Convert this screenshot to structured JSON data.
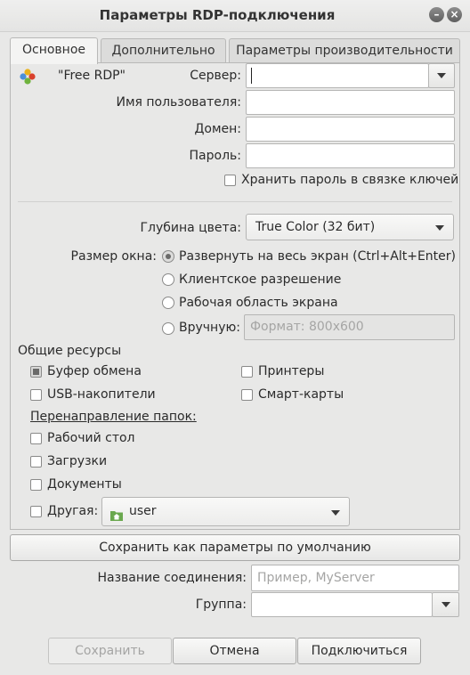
{
  "window": {
    "title": "Параметры RDP-подключения",
    "minimize_glyph": "–",
    "close_glyph": "×"
  },
  "tabs": [
    {
      "label": "Основное",
      "active": true
    },
    {
      "label": "Дополнительно",
      "active": false
    },
    {
      "label": "Параметры производительности",
      "active": false
    }
  ],
  "protocol": {
    "icon": "freerdp-icon",
    "name": "\"Free RDP\""
  },
  "server": {
    "label": "Сервер:",
    "value": ""
  },
  "username": {
    "label": "Имя пользователя:",
    "value": ""
  },
  "domain": {
    "label": "Домен:",
    "value": ""
  },
  "password": {
    "label": "Пароль:",
    "value": ""
  },
  "keyring": {
    "label": "Хранить пароль в связке ключей",
    "checked": false
  },
  "color_depth": {
    "label": "Глубина цвета:",
    "value": "True Color (32 бит)"
  },
  "window_size": {
    "label": "Размер окна:",
    "options": [
      {
        "label": "Развернуть на весь экран (Ctrl+Alt+Enter)",
        "checked": true
      },
      {
        "label": "Клиентское разрешение",
        "checked": false
      },
      {
        "label": "Рабочая область экрана",
        "checked": false
      },
      {
        "label": "Вручную:",
        "checked": false
      }
    ],
    "manual_placeholder": "Формат: 800x600"
  },
  "shared": {
    "heading": "Общие ресурсы",
    "clipboard": {
      "label": "Буфер обмена",
      "checked": true
    },
    "printers": {
      "label": "Принтеры",
      "checked": false
    },
    "usb": {
      "label": "USB-накопители",
      "checked": false
    },
    "smartcards": {
      "label": "Смарт-карты",
      "checked": false
    }
  },
  "folders": {
    "heading": "Перенаправление папок:",
    "desktop": {
      "label": "Рабочий стол",
      "checked": false
    },
    "downloads": {
      "label": "Загрузки",
      "checked": false
    },
    "documents": {
      "label": "Документы",
      "checked": false
    },
    "other": {
      "label": "Другая:",
      "checked": false,
      "folder": "user",
      "folder_icon": "home-folder-icon"
    }
  },
  "save_defaults_label": "Сохранить как параметры по умолчанию",
  "connection_name": {
    "label": "Название соединения:",
    "placeholder": "Пример, MyServer"
  },
  "group": {
    "label": "Группа:",
    "value": ""
  },
  "buttons": {
    "save": "Сохранить",
    "cancel": "Отмена",
    "connect": "Подключиться"
  }
}
